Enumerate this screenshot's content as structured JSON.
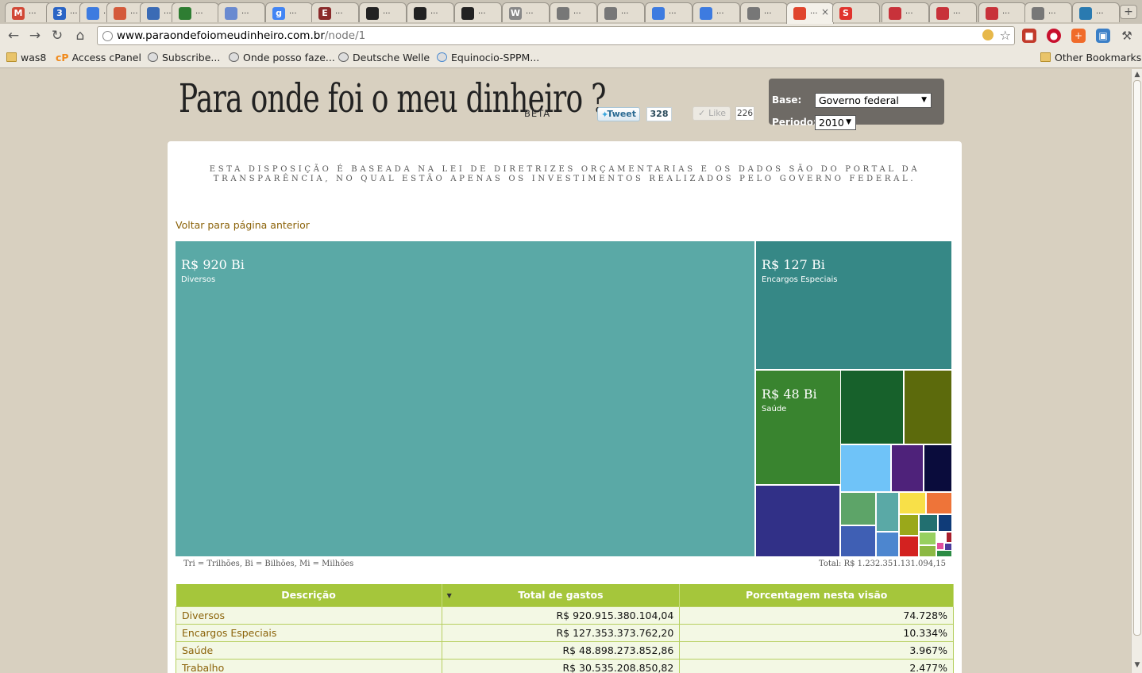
{
  "browser": {
    "tabs": [
      {
        "icon": "gmail-icon",
        "letter": "M",
        "color": "#d14836",
        "label": "..."
      },
      {
        "icon": "calendar-icon",
        "letter": "3",
        "color": "#2a64c5",
        "label": "..."
      },
      {
        "icon": "docs-icon",
        "letter": "",
        "color": "#3d7be0",
        "label": "..."
      },
      {
        "icon": "app-icon",
        "letter": "",
        "color": "#d45a3b",
        "label": "..."
      },
      {
        "icon": "notes-icon",
        "letter": "",
        "color": "#3b6bb5",
        "label": "..."
      },
      {
        "icon": "terminal-icon",
        "letter": "",
        "color": "#2e7d32",
        "label": "..."
      },
      {
        "icon": "planet-icon",
        "letter": "",
        "color": "#6a8ad0",
        "label": "..."
      },
      {
        "icon": "google-icon",
        "letter": "g",
        "color": "#4285f4",
        "label": "..."
      },
      {
        "icon": "e-icon",
        "letter": "E",
        "color": "#8a2b2b",
        "label": "..."
      },
      {
        "icon": "github-icon",
        "letter": "",
        "color": "#222222",
        "label": "..."
      },
      {
        "icon": "github-icon",
        "letter": "",
        "color": "#222222",
        "label": "..."
      },
      {
        "icon": "github-icon",
        "letter": "",
        "color": "#222222",
        "label": "..."
      },
      {
        "icon": "wordpress-icon",
        "letter": "W",
        "color": "#888888",
        "label": "..."
      },
      {
        "icon": "globe-icon",
        "letter": "",
        "color": "#777777",
        "label": "..."
      },
      {
        "icon": "globe-icon",
        "letter": "",
        "color": "#777777",
        "label": "..."
      },
      {
        "icon": "document-icon",
        "letter": "",
        "color": "#3d7be0",
        "label": "..."
      },
      {
        "icon": "document-icon",
        "letter": "",
        "color": "#3d7be0",
        "label": "..."
      },
      {
        "icon": "globe-icon",
        "letter": "",
        "color": "#777777",
        "label": "..."
      },
      {
        "icon": "site-icon",
        "letter": "",
        "color": "#e0452d",
        "label": "..."
      },
      {
        "icon": "s-icon",
        "letter": "S",
        "color": "#e0332d",
        "label": ""
      },
      {
        "icon": "checkmark-icon",
        "letter": "",
        "color": "#c8323a",
        "label": "..."
      },
      {
        "icon": "chain-icon",
        "letter": "",
        "color": "#c8323a",
        "label": "..."
      },
      {
        "icon": "chain-icon",
        "letter": "",
        "color": "#c8323a",
        "label": "..."
      },
      {
        "icon": "globe-icon",
        "letter": "",
        "color": "#777777",
        "label": "..."
      },
      {
        "icon": "star-icon",
        "letter": "",
        "color": "#2a7ab0",
        "label": "..."
      }
    ],
    "url_host": "www.paraondefoiomeudinheiro.com.br",
    "url_path": "/node/1",
    "bookmarks": [
      {
        "icon": "folder-icon",
        "label": "was8"
      },
      {
        "icon": "cpanel-icon",
        "label": "Access cPanel"
      },
      {
        "icon": "globe-icon",
        "label": "Subscribe..."
      },
      {
        "icon": "globe-icon",
        "label": "Onde posso faze..."
      },
      {
        "icon": "globe-icon",
        "label": "Deutsche Welle"
      },
      {
        "icon": "chat-icon",
        "label": "Equinocio-SPPM..."
      }
    ],
    "other_bookmarks": "Other Bookmarks"
  },
  "site": {
    "title": "Para onde foi o meu dinheiro ?",
    "beta": "BETA",
    "tweet_label": "Tweet",
    "tweet_count": "328",
    "like_label": "Like",
    "like_count": "226",
    "filters": {
      "base_label": "Base:",
      "base_value": "Governo federal",
      "period_label": "Periodo:",
      "period_value": "2010"
    },
    "notice": "ESTA DISPOSIÇÃO É BASEADA NA LEI DE DIRETRIZES ORÇAMENTARIAS E OS DADOS SÃO DO PORTAL DA TRANSPARÊNCIA, NO QUAL ESTÃO APENAS OS INVESTIMENTOS REALIZADOS PELO GOVERNO FEDERAL.",
    "back_link": "Voltar para página anterior",
    "legend_units": "Tri = Trilhões, Bi = Bilhões, Mi = Milhões",
    "legend_total": "Total: R$ 1.232.351.131.094,15"
  },
  "chart_data": {
    "type": "treemap",
    "total": 1232351131094.15,
    "labeled_cells": [
      {
        "name": "Diversos",
        "display": "R$ 920 Bi",
        "value": 920915380104.04,
        "color": "#5aa9a6"
      },
      {
        "name": "Encargos Especiais",
        "display": "R$ 127 Bi",
        "value": 127353373762.2,
        "color": "#368886"
      },
      {
        "name": "Saúde",
        "display": "R$ 48 Bi",
        "value": 48898273852.86,
        "color": "#39842f"
      }
    ],
    "unlabeled_cell_colors": [
      "#313087",
      "#17612b",
      "#5c6a0c",
      "#6fc3f8",
      "#4e227a",
      "#0a0c3c",
      "#5da468",
      "#5aa9a6",
      "#f8e048",
      "#ee7439",
      "#3f5fb4",
      "#4d86cf",
      "#9aa81a",
      "#226f70",
      "#0f3b78",
      "#d32220",
      "#97d060",
      "#8cb944",
      "#a81e2c",
      "#e04e9d",
      "#4a3a9c",
      "#2b8b44"
    ]
  },
  "table": {
    "headers": [
      "Descrição",
      "Total de gastos",
      "Porcentagem nesta visão"
    ],
    "rows": [
      [
        "Diversos",
        "R$ 920.915.380.104,04",
        "74.728%"
      ],
      [
        "Encargos Especiais",
        "R$ 127.353.373.762,20",
        "10.334%"
      ],
      [
        "Saúde",
        "R$ 48.898.273.852,86",
        "3.967%"
      ],
      [
        "Trabalho",
        "R$ 30.535.208.850,82",
        "2.477%"
      ]
    ]
  }
}
